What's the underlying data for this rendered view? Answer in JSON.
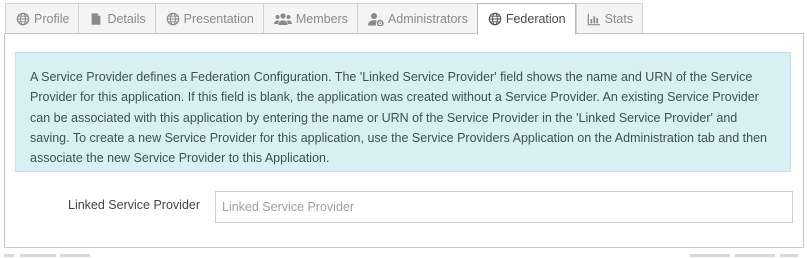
{
  "tabs": [
    {
      "label": "Profile",
      "icon": "globe-icon",
      "active": false
    },
    {
      "label": "Details",
      "icon": "document-icon",
      "active": false
    },
    {
      "label": "Presentation",
      "icon": "globe-icon",
      "active": false
    },
    {
      "label": "Members",
      "icon": "users-icon",
      "active": false
    },
    {
      "label": "Administrators",
      "icon": "user-cog-icon",
      "active": false
    },
    {
      "label": "Federation",
      "icon": "globe-icon",
      "active": true
    },
    {
      "label": "Stats",
      "icon": "bar-chart-icon",
      "active": false
    }
  ],
  "info": {
    "text": "A Service Provider defines a Federation Configuration. The 'Linked Service Provider' field shows the name and URN of the Service Provider for this application. If this field is blank, the application was created without a Service Provider. An existing Service Provider can be associated with this application by entering the name or URN of the Service Provider in the 'Linked Service Provider' and saving. To create a new Service Provider for this application, use the Service Providers Application on the Administration tab and then associate the new Service Provider to this Application."
  },
  "linked_service_provider": {
    "label": "Linked Service Provider",
    "placeholder": "Linked Service Provider",
    "value": ""
  },
  "colors": {
    "info_background": "#d8f0f4",
    "tab_inactive_text": "#8a8a8a",
    "tab_active_text": "#4a4a4a"
  }
}
